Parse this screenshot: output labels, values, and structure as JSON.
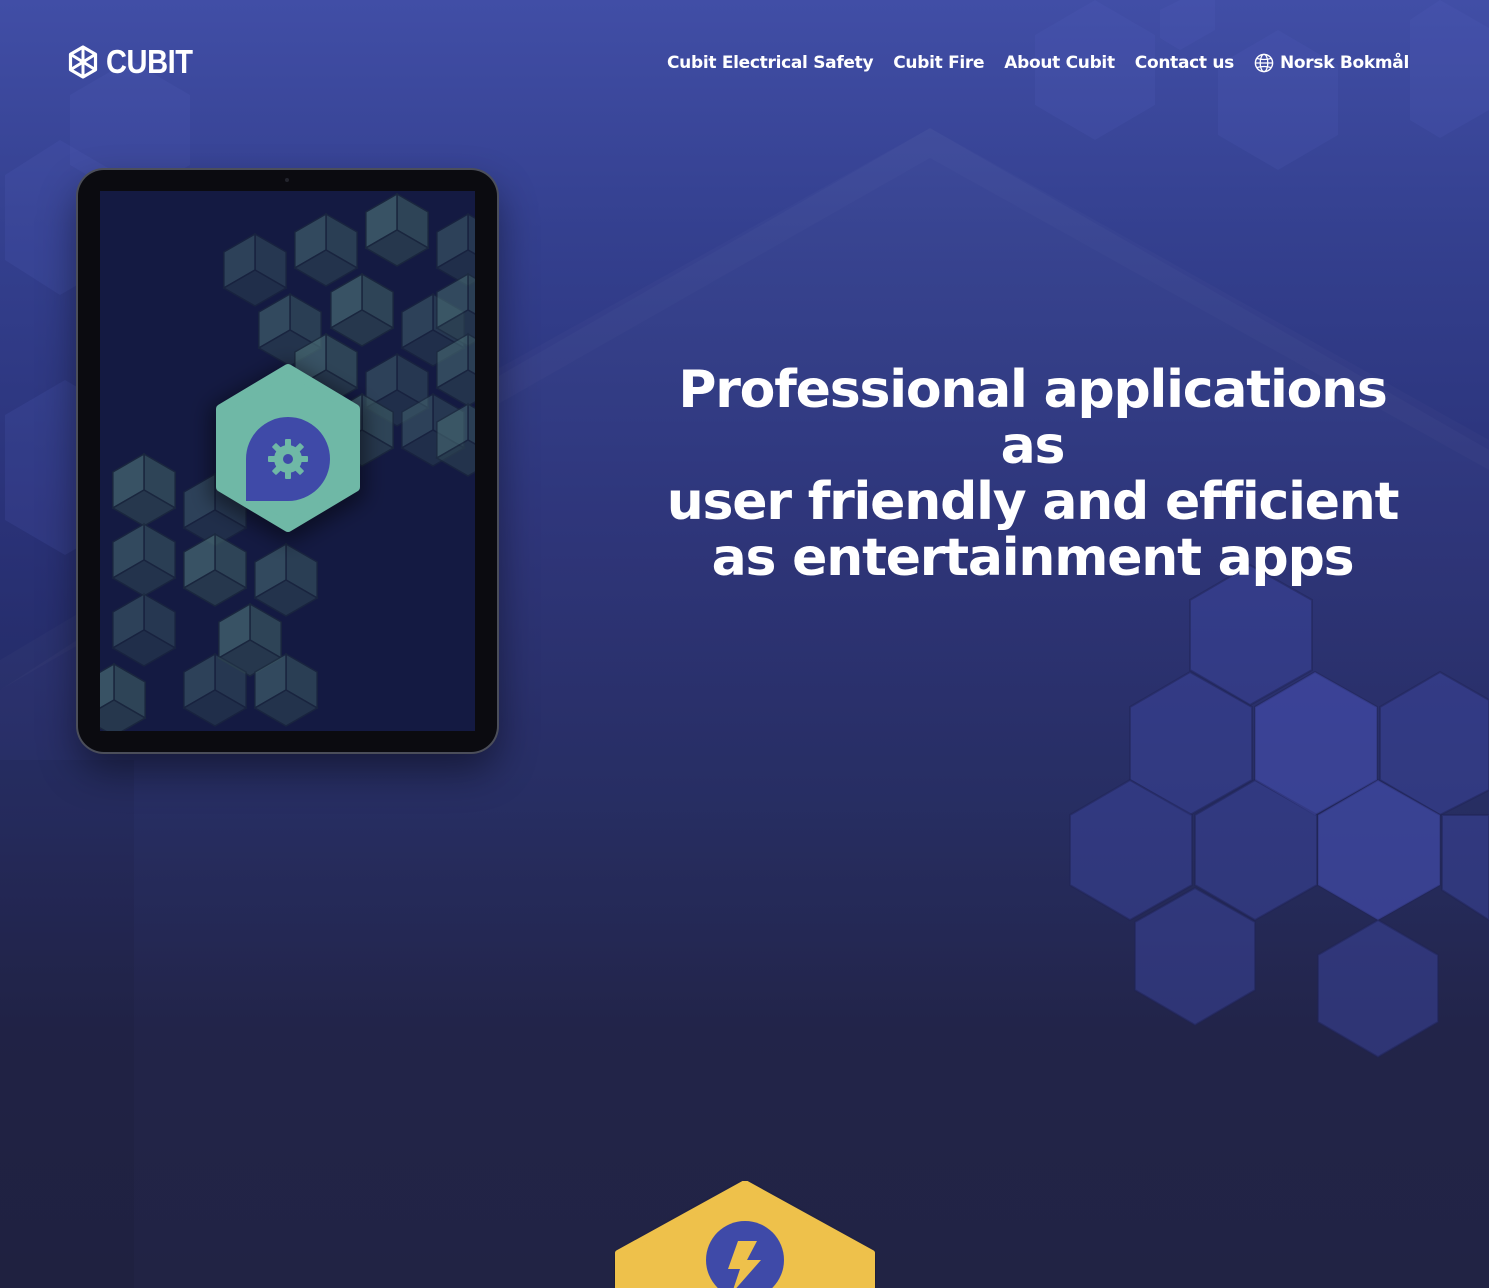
{
  "brand": {
    "name": "CUBIT",
    "logo_icon": "cubit-logo-icon"
  },
  "nav": {
    "items": [
      {
        "label": "Cubit Electrical Safety"
      },
      {
        "label": "Cubit Fire"
      },
      {
        "label": "About Cubit"
      },
      {
        "label": "Contact us"
      }
    ],
    "language": {
      "label": "Norsk Bokmål",
      "icon": "globe-icon"
    }
  },
  "hero": {
    "title_lines": [
      "Professional applications as",
      "user friendly and efficient",
      "as entertainment apps"
    ]
  },
  "tablet": {
    "app_icon": "gear-pin-icon"
  },
  "badge": {
    "icon": "lightning-bolt-icon"
  },
  "colors": {
    "background_top": "#414ea6",
    "background_bottom": "#1c1e40",
    "accent_teal": "#6fb8a6",
    "accent_blue": "#3f4aa8",
    "accent_yellow": "#eec14b",
    "text": "#ffffff"
  }
}
